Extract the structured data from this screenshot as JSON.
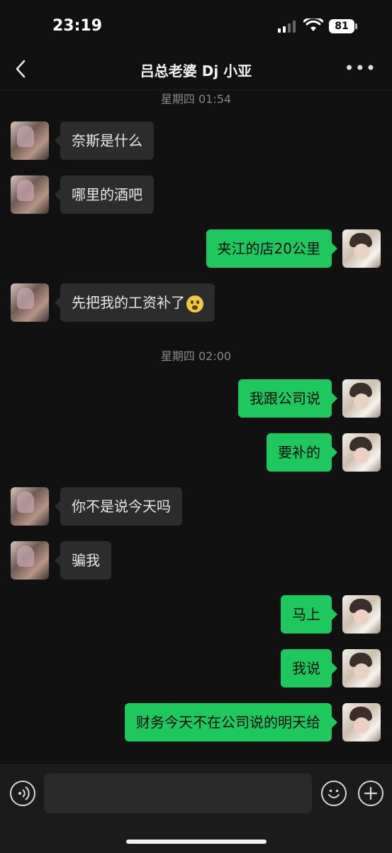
{
  "status_bar": {
    "time": "23:19",
    "battery": "81"
  },
  "header": {
    "title": "吕总老婆 Dj 小亚"
  },
  "chat": {
    "timestamps": [
      {
        "label": "星期四 01:54"
      },
      {
        "label": "星期四 02:00"
      }
    ],
    "messages": [
      {
        "side": "left",
        "text": "奈斯是什么"
      },
      {
        "side": "left",
        "text": "哪里的酒吧"
      },
      {
        "side": "right",
        "text": "夹江的店20公里"
      },
      {
        "side": "left",
        "text": "先把我的工资补了",
        "emoji": "flushed-emoji"
      },
      {
        "side": "right",
        "text": "我跟公司说"
      },
      {
        "side": "right",
        "text": "要补的"
      },
      {
        "side": "left",
        "text": "你不是说今天吗"
      },
      {
        "side": "left",
        "text": "骗我"
      },
      {
        "side": "right",
        "text": "马上"
      },
      {
        "side": "right",
        "text": "我说"
      },
      {
        "side": "right",
        "text": "财务今天不在公司说的明天给"
      }
    ]
  },
  "input_bar": {
    "value": ""
  },
  "colors": {
    "background": "#111111",
    "incoming_bubble": "#2c2c2c",
    "outgoing_bubble": "#1fc75f"
  }
}
